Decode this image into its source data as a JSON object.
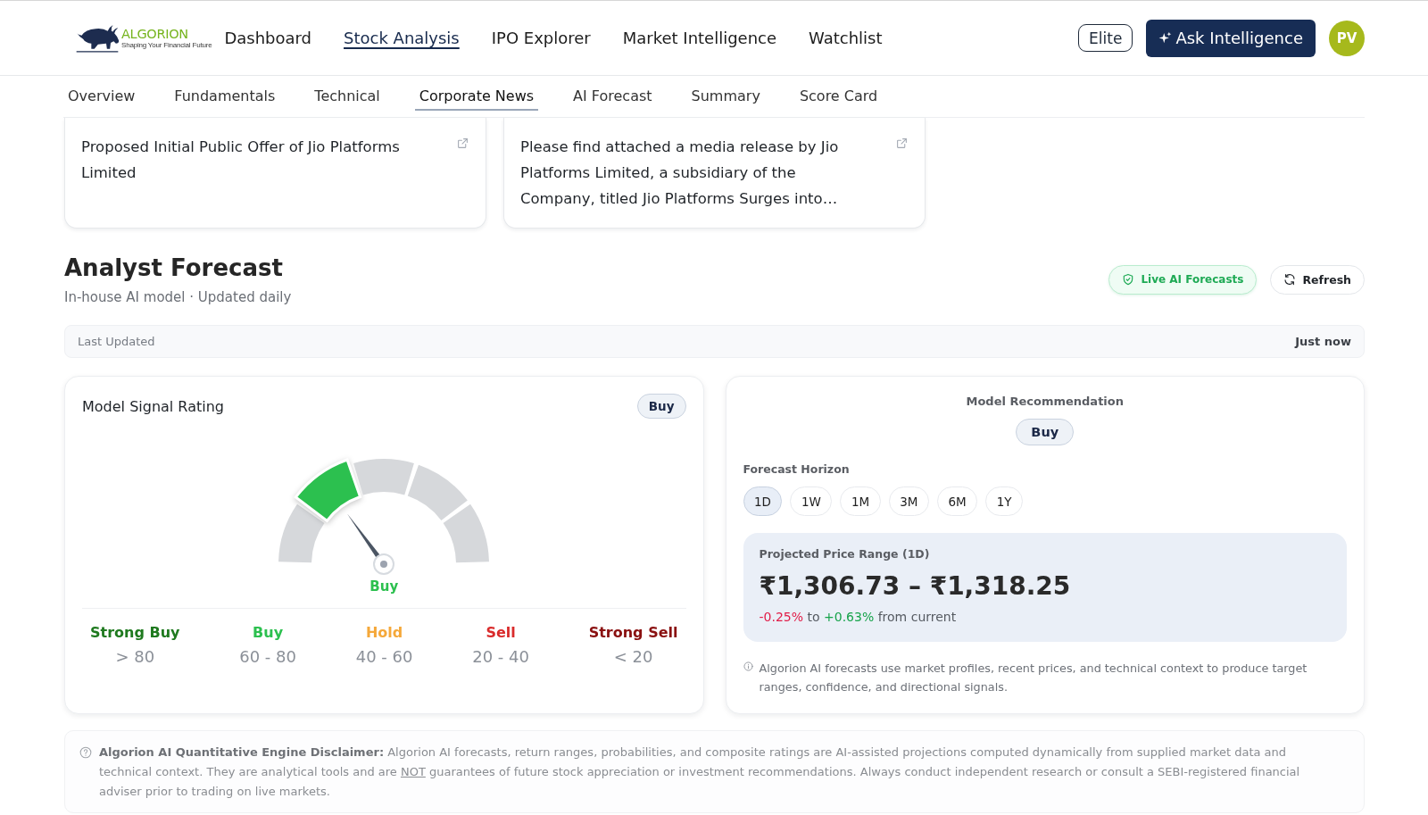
{
  "header": {
    "logo": {
      "name": "ALGORION",
      "tagline": "Shaping Your Financial Future"
    },
    "nav": [
      {
        "label": "Dashboard",
        "selected": false
      },
      {
        "label": "Stock Analysis",
        "selected": true
      },
      {
        "label": "IPO Explorer",
        "selected": false
      },
      {
        "label": "Market Intelligence",
        "selected": false
      },
      {
        "label": "Watchlist",
        "selected": false
      }
    ],
    "plan_badge": "Elite",
    "ask_button": "Ask Intelligence",
    "avatar": "PV"
  },
  "subnav": [
    {
      "label": "Overview",
      "selected": false
    },
    {
      "label": "Fundamentals",
      "selected": false
    },
    {
      "label": "Technical",
      "selected": false
    },
    {
      "label": "Corporate News",
      "selected": true
    },
    {
      "label": "AI Forecast",
      "selected": false
    },
    {
      "label": "Summary",
      "selected": false
    },
    {
      "label": "Score Card",
      "selected": false
    }
  ],
  "news_cards": [
    {
      "title": "Proposed Initial Public Offer of Jio Platforms Limited"
    },
    {
      "title": "Please find attached a media release by Jio Platforms Limited, a subsidiary of the Company, titled Jio Platforms Surges into…"
    }
  ],
  "analyst_forecast": {
    "title": "Analyst Forecast",
    "subtitle": "In-house AI model · Updated daily",
    "live_button": "Live AI Forecasts",
    "refresh_button": "Refresh",
    "last_updated": {
      "label": "Last Updated",
      "value": "Just now"
    }
  },
  "signal_card": {
    "title": "Model Signal Rating",
    "badge": "Buy",
    "gauge_reading": "Buy",
    "scale": [
      {
        "label": "Strong Buy",
        "range": "> 80",
        "color": "#1f7a1f",
        "selected": false
      },
      {
        "label": "Buy",
        "range": "60 - 80",
        "color": "#2cc04f",
        "selected": true
      },
      {
        "label": "Hold",
        "range": "40 - 60",
        "color": "#f5a83a",
        "selected": false
      },
      {
        "label": "Sell",
        "range": "20 - 40",
        "color": "#d92b2b",
        "selected": false
      },
      {
        "label": "Strong Sell",
        "range": "< 20",
        "color": "#8a1010",
        "selected": false
      }
    ]
  },
  "recommendation_card": {
    "title": "Model Recommendation",
    "badge": "Buy",
    "horizon_label": "Forecast Horizon",
    "horizons": [
      {
        "label": "1D",
        "selected": true
      },
      {
        "label": "1W",
        "selected": false
      },
      {
        "label": "1M",
        "selected": false
      },
      {
        "label": "3M",
        "selected": false
      },
      {
        "label": "6M",
        "selected": false
      },
      {
        "label": "1Y",
        "selected": false
      }
    ],
    "projection": {
      "label": "Projected Price Range (1D)",
      "range": "₹1,306.73 – ₹1,318.25",
      "change": {
        "low": "-0.25%",
        "joiner": "to",
        "high": "+0.63%",
        "suffix": "from current"
      }
    },
    "note": "Algorion AI forecasts use market profiles, recent prices, and technical context to produce target ranges, confidence, and directional signals."
  },
  "disclaimer": {
    "heading": "Algorion AI Quantitative Engine Disclaimer:",
    "before": "Algorion AI forecasts, return ranges, probabilities, and composite ratings are AI-assisted projections computed dynamically from supplied market data and technical context. They are analytical tools and are",
    "underlined": "NOT",
    "after": "guarantees of future stock appreciation or investment recommendations. Always conduct independent research or consult a SEBI-registered financial adviser prior to trading on live markets."
  }
}
